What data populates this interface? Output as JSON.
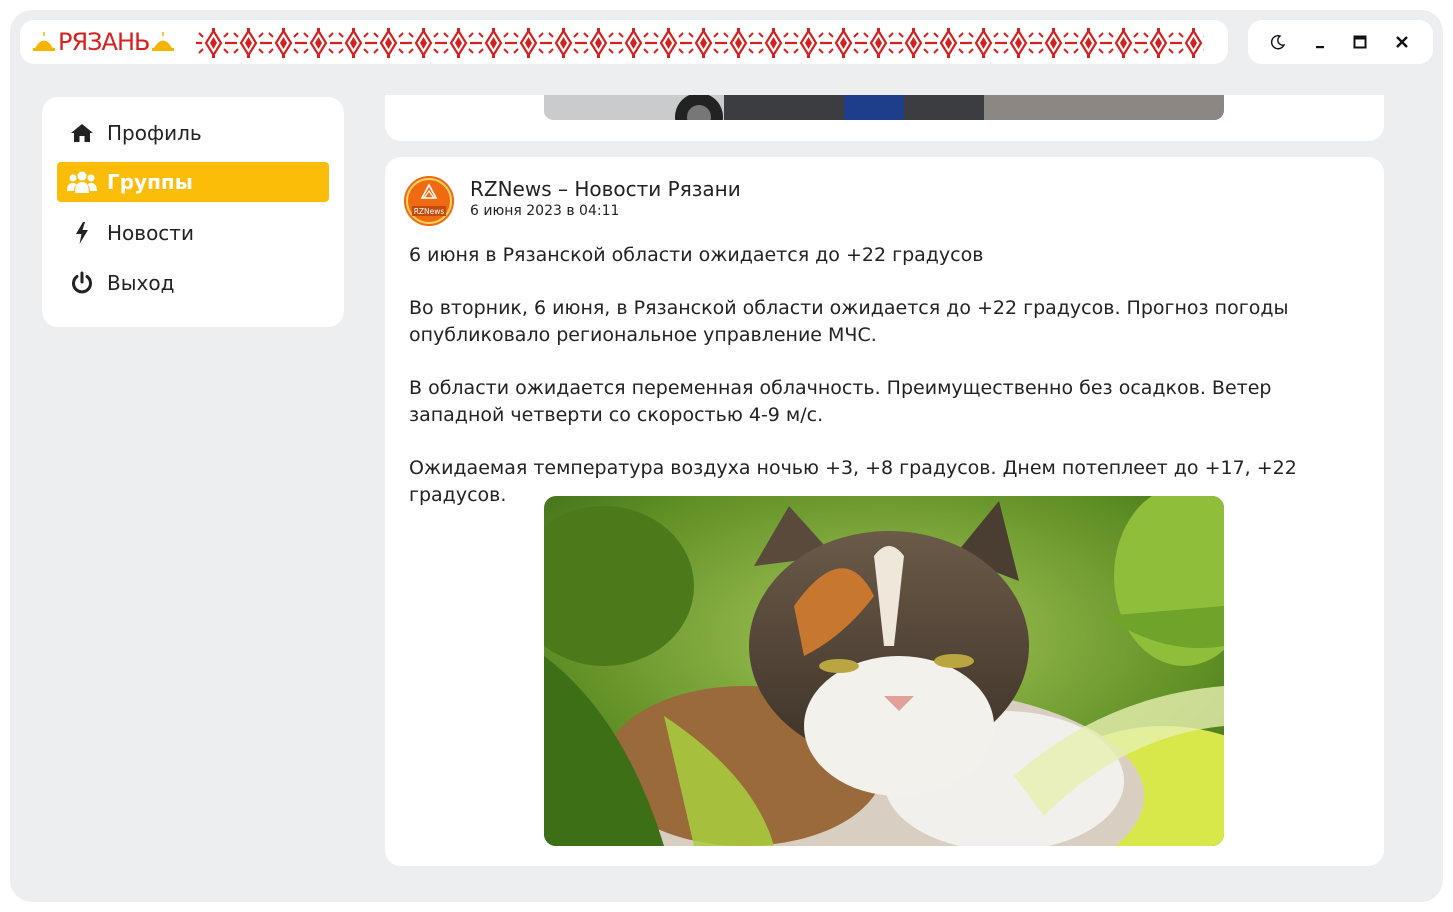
{
  "header": {
    "logo_text": "РЯЗАНЬ",
    "theme_toggle_icon": "moon-icon",
    "minimize_icon": "minimize-icon",
    "maximize_icon": "maximize-icon",
    "close_icon": "close-icon"
  },
  "sidebar": {
    "items": [
      {
        "label": "Профиль",
        "icon": "home-icon",
        "active": false
      },
      {
        "label": "Группы",
        "icon": "users-icon",
        "active": true
      },
      {
        "label": "Новости",
        "icon": "bolt-icon",
        "active": false
      },
      {
        "label": "Выход",
        "icon": "power-icon",
        "active": false
      }
    ]
  },
  "post": {
    "avatar_text": "RZNews",
    "author": "RZNews – Новости Рязани",
    "date": "6 июня 2023 в 04:11",
    "paragraphs": [
      "6 июня в Рязанской области ожидается до +22 градусов",
      "Во вторник, 6 июня, в Рязанской области ожидается до +22 градусов. Прогноз погоды опубликовало региональное управление МЧС.",
      "В области ожидается переменная облачность. Преимущественно без осадков. Ветер западной четверти со скоростью 4-9 м/с.",
      "Ожидаемая температура воздуха ночью +3, +8 градусов. Днем потеплеет до +17, +22 градусов."
    ]
  },
  "colors": {
    "accent": "#fbbd08",
    "brand_red": "#d4201f",
    "background": "#eceef0"
  }
}
